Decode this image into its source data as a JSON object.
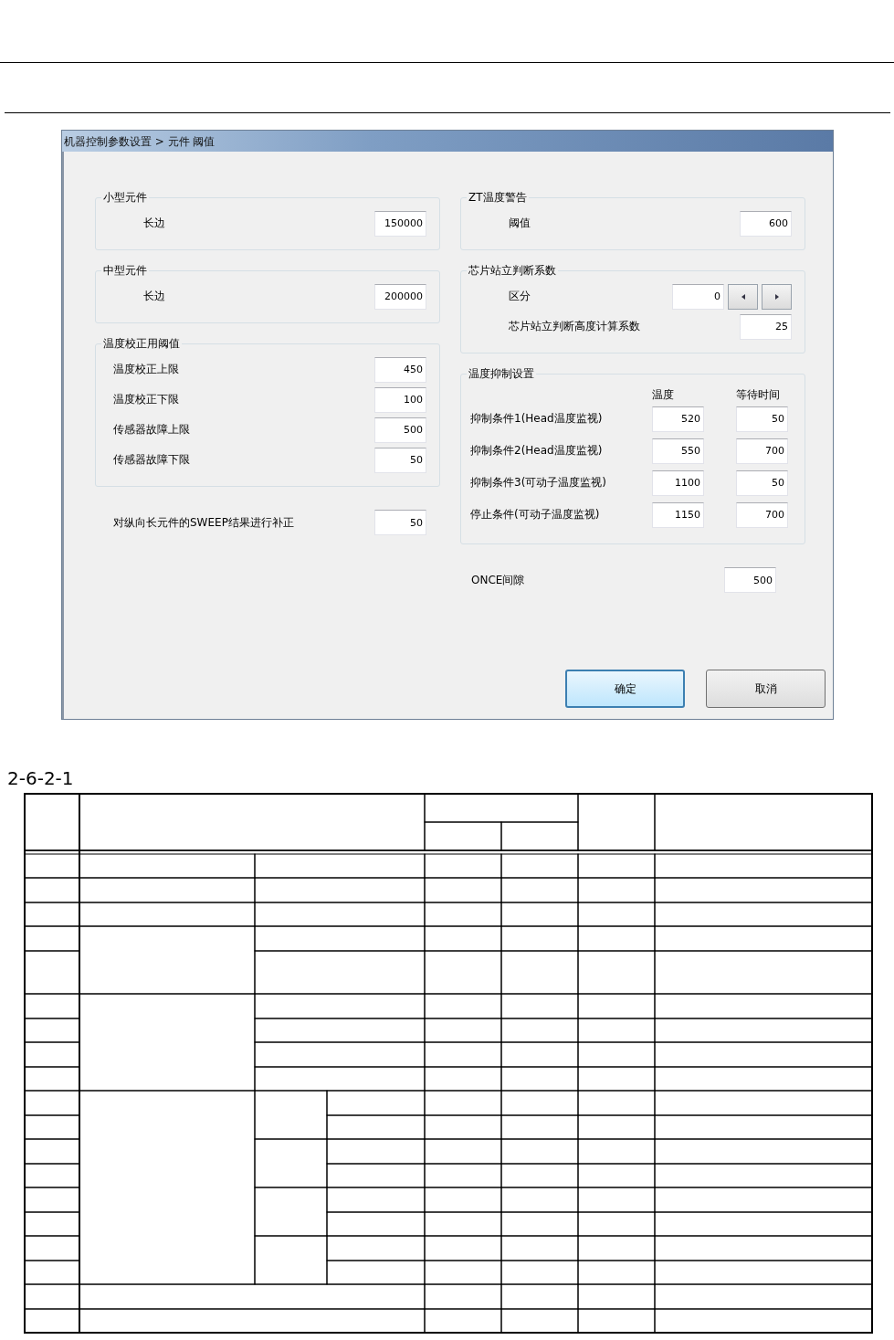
{
  "window": {
    "title": "机器控制参数设置 > 元件 阈值"
  },
  "left": [
    {
      "kind": "group",
      "title": "小型元件",
      "fields": [
        {
          "kind": "text",
          "label": "长边",
          "value": "150000"
        }
      ]
    },
    {
      "kind": "group",
      "title": "中型元件",
      "fields": [
        {
          "kind": "text",
          "label": "长边",
          "value": "200000"
        }
      ]
    },
    {
      "kind": "list",
      "title": "温度校正用阈值",
      "fields": [
        {
          "kind": "text",
          "label": "温度校正上限",
          "value": "450"
        },
        {
          "kind": "text",
          "label": "温度校正下限",
          "value": "100"
        },
        {
          "kind": "text",
          "label": "传感器故障上限",
          "value": "500"
        },
        {
          "kind": "text",
          "label": "传感器故障下限",
          "value": "50"
        }
      ]
    },
    {
      "kind": "row",
      "label": "对纵向长元件的SWEEP结果进行补正",
      "value": "50"
    }
  ],
  "right": [
    {
      "kind": "group",
      "title": "ZT温度警告",
      "fields": [
        {
          "kind": "text",
          "label": "阈值",
          "value": "600"
        }
      ]
    },
    {
      "kind": "group",
      "title": "芯片站立判断系数",
      "fields": [
        {
          "kind": "spinner",
          "label": "区分",
          "value": "0"
        },
        {
          "kind": "text",
          "label": "芯片站立判断高度计算系数",
          "value": "25"
        }
      ]
    },
    {
      "kind": "table",
      "title": "温度抑制设置",
      "columns": [
        "温度",
        "等待时间"
      ],
      "rows": [
        {
          "label": "抑制条件1(Head温度监视)",
          "values": [
            "520",
            "50"
          ]
        },
        {
          "label": "抑制条件2(Head温度监视)",
          "values": [
            "550",
            "700"
          ]
        },
        {
          "label": "抑制条件3(可动子温度监视)",
          "values": [
            "1100",
            "50"
          ]
        },
        {
          "label": "停止条件(可动子温度监视)",
          "values": [
            "1150",
            "700"
          ]
        }
      ]
    },
    {
      "kind": "row",
      "label": "ONCE间隙",
      "value": "500"
    }
  ],
  "buttons": [
    {
      "label": "确定",
      "default": true
    },
    {
      "label": "取消",
      "default": false
    }
  ],
  "caption": "2-6-2-1"
}
